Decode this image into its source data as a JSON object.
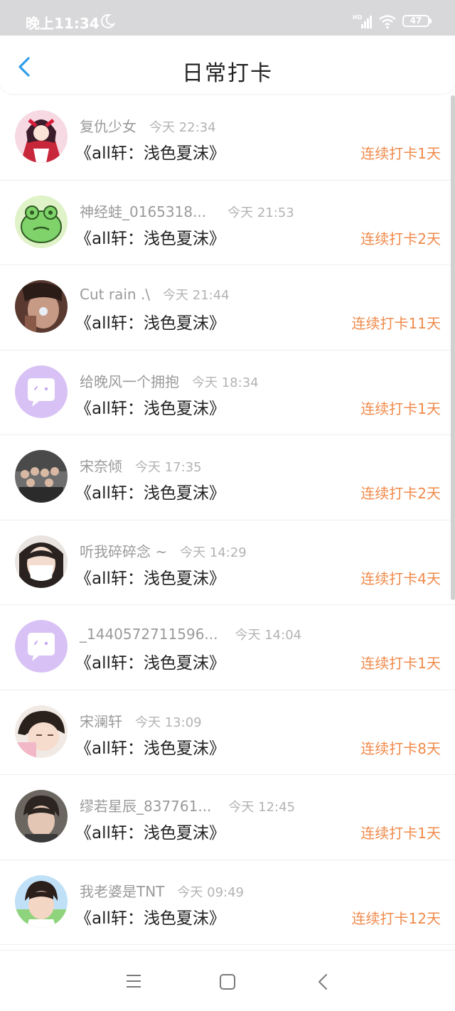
{
  "status_bar": {
    "time": "晚上11:34",
    "battery": "47"
  },
  "header": {
    "title": "日常打卡"
  },
  "checkins": [
    {
      "name": "复仇少女",
      "time": "今天 22:34",
      "book": "《all轩：浅色夏沫》",
      "streak": "连续打卡1天",
      "avatar": "anime-girl-avatar"
    },
    {
      "name": "神经蛙_0165318...",
      "time": "今天 21:53",
      "book": "《all轩：浅色夏沫》",
      "streak": "连续打卡2天",
      "avatar": "frog-avatar"
    },
    {
      "name": "Cut rain .\\",
      "time": "今天 21:44",
      "book": "《all轩：浅色夏沫》",
      "streak": "连续打卡11天",
      "avatar": "photo-avatar"
    },
    {
      "name": "给晚风一个拥抱",
      "time": "今天 18:34",
      "book": "《all轩：浅色夏沫》",
      "streak": "连续打卡1天",
      "avatar": "default-avatar"
    },
    {
      "name": "宋奈倾",
      "time": "今天 17:35",
      "book": "《all轩：浅色夏沫》",
      "streak": "连续打卡2天",
      "avatar": "group-photo-avatar"
    },
    {
      "name": "听我碎碎念 ~",
      "time": "今天 14:29",
      "book": "《all轩：浅色夏沫》",
      "streak": "连续打卡4天",
      "avatar": "masked-girl-avatar"
    },
    {
      "name": "_1440572711596...",
      "time": "今天 14:04",
      "book": "《all轩：浅色夏沫》",
      "streak": "连续打卡1天",
      "avatar": "default-avatar"
    },
    {
      "name": "宋澜轩",
      "time": "今天 13:09",
      "book": "《all轩：浅色夏沫》",
      "streak": "连续打卡8天",
      "avatar": "sleeping-boy-avatar"
    },
    {
      "name": "缪若星辰_837761...",
      "time": "今天 12:45",
      "book": "《all轩：浅色夏沫》",
      "streak": "连续打卡1天",
      "avatar": "boy-portrait-avatar"
    },
    {
      "name": "我老婆是TNT",
      "time": "今天 09:49",
      "book": "《all轩：浅色夏沫》",
      "streak": "连续打卡12天",
      "avatar": "boy-green-avatar"
    }
  ],
  "colors": {
    "accent": "#f08a4b",
    "back_arrow": "#2f9ee8",
    "default_avatar_bg": "#d8c2f5"
  }
}
